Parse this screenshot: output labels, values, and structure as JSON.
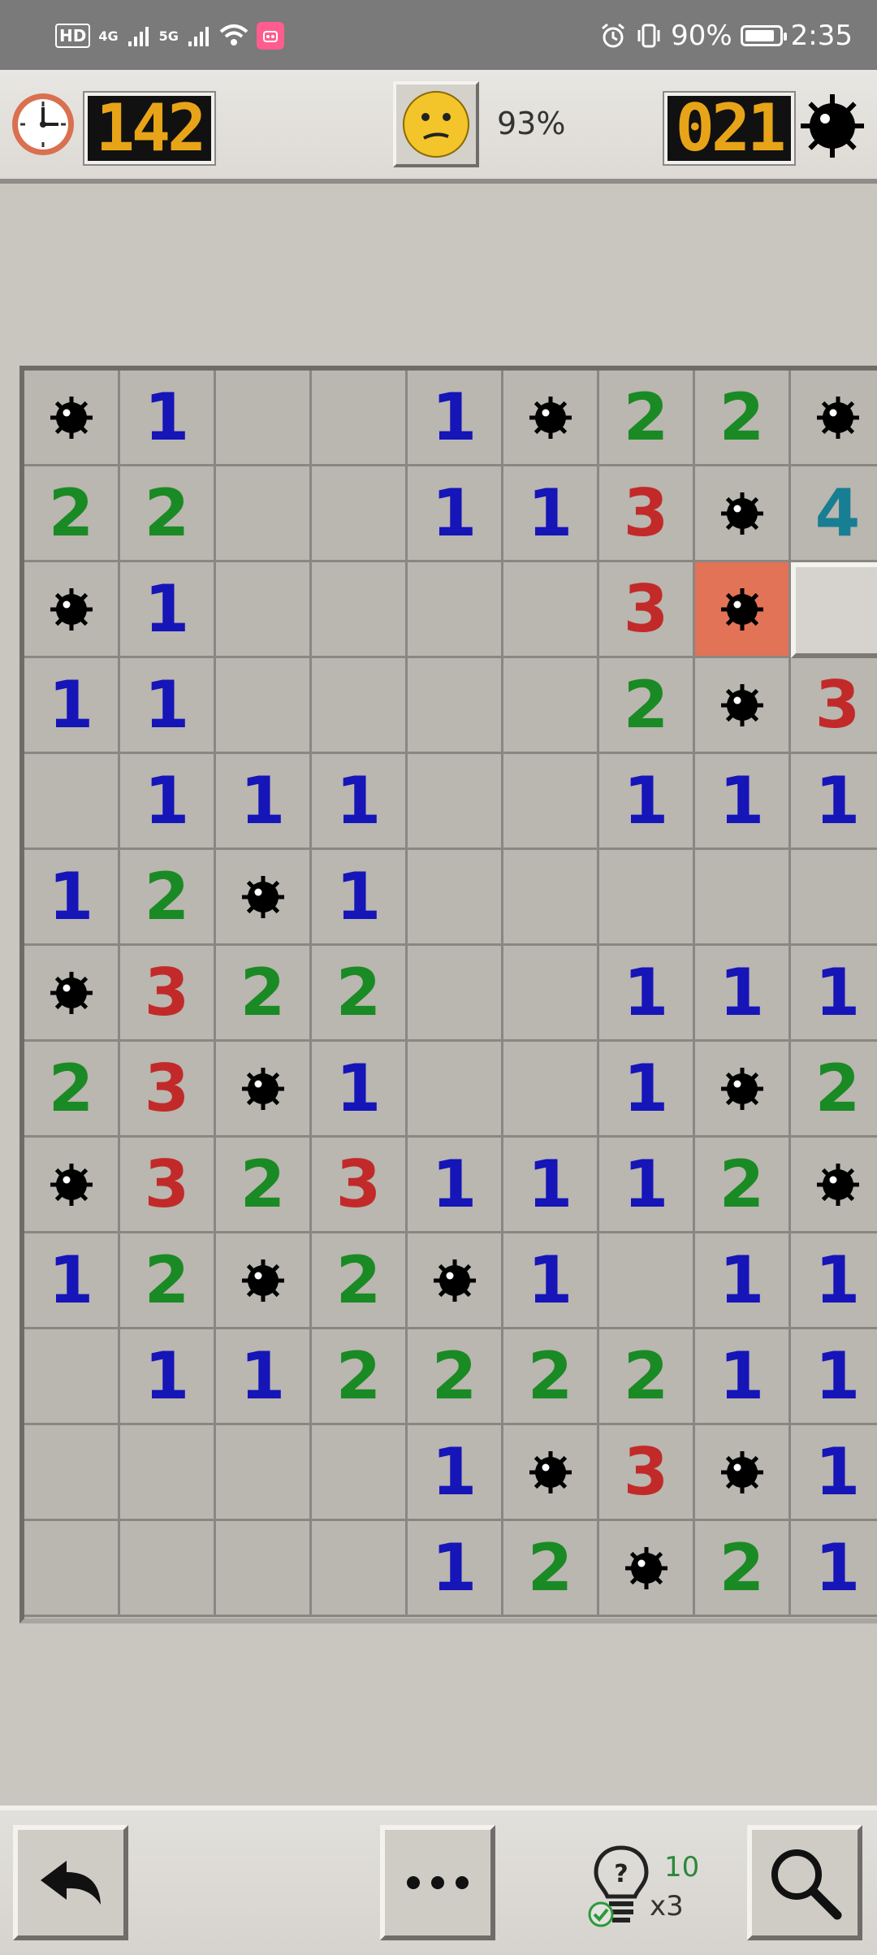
{
  "status_bar": {
    "hd_label": "HD",
    "sim1_label": "4G",
    "sim2_label": "5G",
    "app_badge": "",
    "battery_percent": "90%",
    "battery_level": 0.9,
    "time": "2:35"
  },
  "game_bar": {
    "timer": "142",
    "smiley_state": "confused",
    "progress_percent": "93%",
    "mines_remaining": "021"
  },
  "board": {
    "columns_visible": 9,
    "rows": [
      [
        "mine",
        "1",
        "",
        "",
        "1",
        "mine",
        "2",
        "2",
        "mine"
      ],
      [
        "2",
        "2",
        "",
        "",
        "1",
        "1",
        "3",
        "mine",
        "4"
      ],
      [
        "mine",
        "1",
        "",
        "",
        "",
        "",
        "3",
        "exploded",
        "covered"
      ],
      [
        "1",
        "1",
        "",
        "",
        "",
        "",
        "2",
        "mine",
        "3"
      ],
      [
        "",
        "1",
        "1",
        "1",
        "",
        "",
        "1",
        "1",
        "1"
      ],
      [
        "1",
        "2",
        "mine",
        "1",
        "",
        "",
        "",
        "",
        ""
      ],
      [
        "mine",
        "3",
        "2",
        "2",
        "",
        "",
        "1",
        "1",
        "1"
      ],
      [
        "2",
        "3",
        "mine",
        "1",
        "",
        "",
        "1",
        "mine",
        "2"
      ],
      [
        "mine",
        "3",
        "2",
        "3",
        "1",
        "1",
        "1",
        "2",
        "mine"
      ],
      [
        "1",
        "2",
        "mine",
        "2",
        "mine",
        "1",
        "",
        "1",
        "1"
      ],
      [
        "",
        "1",
        "1",
        "2",
        "2",
        "2",
        "2",
        "1",
        "1"
      ],
      [
        "",
        "",
        "",
        "",
        "1",
        "mine",
        "3",
        "mine",
        "1"
      ],
      [
        "",
        "",
        "",
        "",
        "1",
        "2",
        "mine",
        "2",
        "1"
      ]
    ]
  },
  "bottom_bar": {
    "undo_icon": "undo-arrow-icon",
    "menu_icon": "more-dots-icon",
    "hint_icon": "lightbulb-question-icon",
    "hint_count": "10",
    "hint_multiplier": "x3",
    "zoom_icon": "magnifier-icon"
  },
  "colors": {
    "one": "#1515b8",
    "two": "#1a8a24",
    "three": "#c22a2a",
    "four": "#177e93",
    "lcd_digits": "#e8a418",
    "exploded": "#e27357"
  }
}
